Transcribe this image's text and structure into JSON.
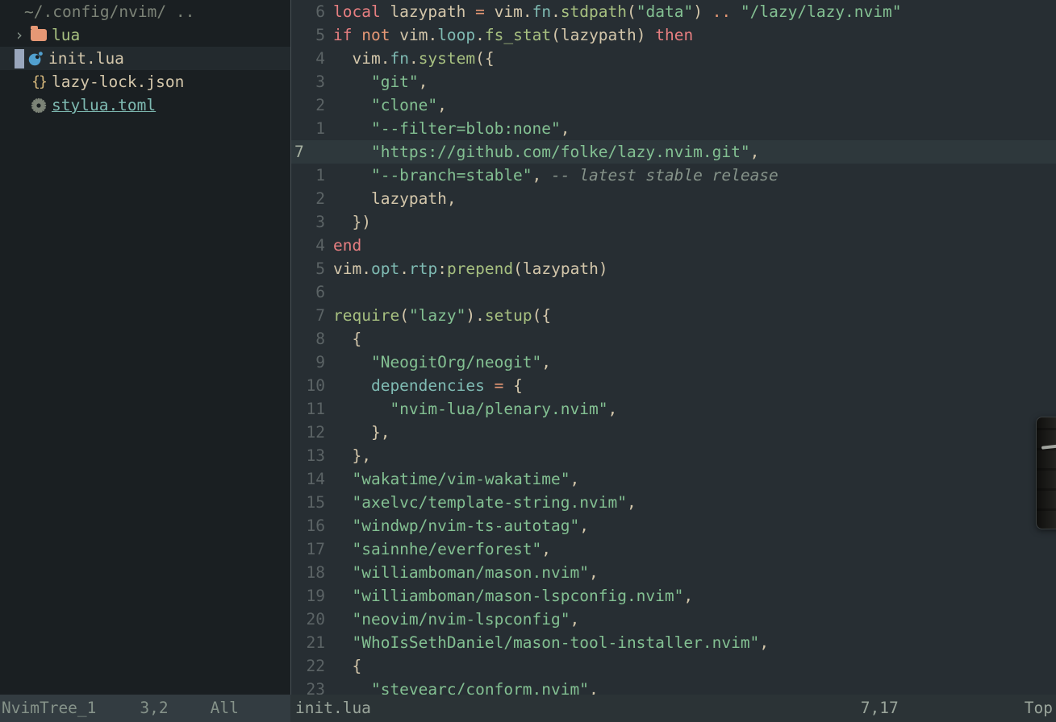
{
  "tree": {
    "root_label": "~/.config/nvim/ ..",
    "items": [
      {
        "icon": "chevron-right-icon",
        "type": "dir",
        "label": "lua",
        "selected": false,
        "indent": 1
      },
      {
        "icon": "lua-icon",
        "type": "file",
        "label": "init.lua",
        "selected": true,
        "indent": 1
      },
      {
        "icon": "json-icon",
        "type": "file",
        "label": "lazy-lock.json",
        "selected": false,
        "indent": 1
      },
      {
        "icon": "gear-icon",
        "type": "link",
        "label": "stylua.toml",
        "selected": false,
        "indent": 1
      }
    ]
  },
  "editor": {
    "filetype": "lua",
    "cursor_line_number": 7,
    "lines": [
      {
        "num": "6",
        "cursor": false,
        "tokens": [
          {
            "t": "kw",
            "v": "local"
          },
          {
            "t": "var",
            "v": " lazypath "
          },
          {
            "t": "op",
            "v": "="
          },
          {
            "t": "var",
            "v": " vim"
          },
          {
            "t": "punct",
            "v": "."
          },
          {
            "t": "field",
            "v": "fn"
          },
          {
            "t": "punct",
            "v": "."
          },
          {
            "t": "func",
            "v": "stdpath"
          },
          {
            "t": "punct",
            "v": "("
          },
          {
            "t": "str",
            "v": "\"data\""
          },
          {
            "t": "punct",
            "v": ")"
          },
          {
            "t": "op",
            "v": " .. "
          },
          {
            "t": "str",
            "v": "\"/lazy/lazy.nvim\""
          }
        ]
      },
      {
        "num": "5",
        "cursor": false,
        "tokens": [
          {
            "t": "kw",
            "v": "if "
          },
          {
            "t": "op",
            "v": "not"
          },
          {
            "t": "var",
            "v": " vim"
          },
          {
            "t": "punct",
            "v": "."
          },
          {
            "t": "field",
            "v": "loop"
          },
          {
            "t": "punct",
            "v": "."
          },
          {
            "t": "func",
            "v": "fs_stat"
          },
          {
            "t": "punct",
            "v": "("
          },
          {
            "t": "var",
            "v": "lazypath"
          },
          {
            "t": "punct",
            "v": ") "
          },
          {
            "t": "kw",
            "v": "then"
          }
        ]
      },
      {
        "num": "4",
        "cursor": false,
        "tokens": [
          {
            "t": "var",
            "v": "  vim"
          },
          {
            "t": "punct",
            "v": "."
          },
          {
            "t": "field",
            "v": "fn"
          },
          {
            "t": "punct",
            "v": "."
          },
          {
            "t": "func",
            "v": "system"
          },
          {
            "t": "punct",
            "v": "({"
          }
        ]
      },
      {
        "num": "3",
        "cursor": false,
        "tokens": [
          {
            "t": "str",
            "v": "    \"git\""
          },
          {
            "t": "punct",
            "v": ","
          }
        ]
      },
      {
        "num": "2",
        "cursor": false,
        "tokens": [
          {
            "t": "str",
            "v": "    \"clone\""
          },
          {
            "t": "punct",
            "v": ","
          }
        ]
      },
      {
        "num": "1",
        "cursor": false,
        "tokens": [
          {
            "t": "str",
            "v": "    \"--filter=blob:none\""
          },
          {
            "t": "punct",
            "v": ","
          }
        ]
      },
      {
        "num": "7",
        "cursor": true,
        "tokens": [
          {
            "t": "str",
            "v": "    \"https://github.com/folke/lazy.nvim.git\""
          },
          {
            "t": "punct",
            "v": ","
          }
        ]
      },
      {
        "num": "1",
        "cursor": false,
        "tokens": [
          {
            "t": "str",
            "v": "    \"--branch=stable\""
          },
          {
            "t": "punct",
            "v": ", "
          },
          {
            "t": "comment",
            "v": "-- latest stable release"
          }
        ]
      },
      {
        "num": "2",
        "cursor": false,
        "tokens": [
          {
            "t": "var",
            "v": "    lazypath"
          },
          {
            "t": "punct",
            "v": ","
          }
        ]
      },
      {
        "num": "3",
        "cursor": false,
        "tokens": [
          {
            "t": "punct",
            "v": "  })"
          }
        ]
      },
      {
        "num": "4",
        "cursor": false,
        "tokens": [
          {
            "t": "kw",
            "v": "end"
          }
        ]
      },
      {
        "num": "5",
        "cursor": false,
        "tokens": [
          {
            "t": "var",
            "v": "vim"
          },
          {
            "t": "punct",
            "v": "."
          },
          {
            "t": "field",
            "v": "opt"
          },
          {
            "t": "punct",
            "v": "."
          },
          {
            "t": "field",
            "v": "rtp"
          },
          {
            "t": "punct",
            "v": ":"
          },
          {
            "t": "func",
            "v": "prepend"
          },
          {
            "t": "punct",
            "v": "("
          },
          {
            "t": "var",
            "v": "lazypath"
          },
          {
            "t": "punct",
            "v": ")"
          }
        ]
      },
      {
        "num": "6",
        "cursor": false,
        "tokens": []
      },
      {
        "num": "7",
        "cursor": false,
        "tokens": [
          {
            "t": "func",
            "v": "require"
          },
          {
            "t": "punct",
            "v": "("
          },
          {
            "t": "str",
            "v": "\"lazy\""
          },
          {
            "t": "punct",
            "v": ")."
          },
          {
            "t": "func",
            "v": "setup"
          },
          {
            "t": "punct",
            "v": "({"
          }
        ]
      },
      {
        "num": "8",
        "cursor": false,
        "tokens": [
          {
            "t": "punct",
            "v": "  {"
          }
        ]
      },
      {
        "num": "9",
        "cursor": false,
        "tokens": [
          {
            "t": "str",
            "v": "    \"NeogitOrg/neogit\""
          },
          {
            "t": "punct",
            "v": ","
          }
        ]
      },
      {
        "num": "10",
        "cursor": false,
        "tokens": [
          {
            "t": "field",
            "v": "    dependencies"
          },
          {
            "t": "op",
            "v": " = "
          },
          {
            "t": "punct",
            "v": "{"
          }
        ]
      },
      {
        "num": "11",
        "cursor": false,
        "tokens": [
          {
            "t": "str",
            "v": "      \"nvim-lua/plenary.nvim\""
          },
          {
            "t": "punct",
            "v": ","
          }
        ]
      },
      {
        "num": "12",
        "cursor": false,
        "tokens": [
          {
            "t": "punct",
            "v": "    },"
          }
        ]
      },
      {
        "num": "13",
        "cursor": false,
        "tokens": [
          {
            "t": "punct",
            "v": "  },"
          }
        ]
      },
      {
        "num": "14",
        "cursor": false,
        "tokens": [
          {
            "t": "str",
            "v": "  \"wakatime/vim-wakatime\""
          },
          {
            "t": "punct",
            "v": ","
          }
        ]
      },
      {
        "num": "15",
        "cursor": false,
        "tokens": [
          {
            "t": "str",
            "v": "  \"axelvc/template-string.nvim\""
          },
          {
            "t": "punct",
            "v": ","
          }
        ]
      },
      {
        "num": "16",
        "cursor": false,
        "tokens": [
          {
            "t": "str",
            "v": "  \"windwp/nvim-ts-autotag\""
          },
          {
            "t": "punct",
            "v": ","
          }
        ]
      },
      {
        "num": "17",
        "cursor": false,
        "tokens": [
          {
            "t": "str",
            "v": "  \"sainnhe/everforest\""
          },
          {
            "t": "punct",
            "v": ","
          }
        ]
      },
      {
        "num": "18",
        "cursor": false,
        "tokens": [
          {
            "t": "str",
            "v": "  \"williamboman/mason.nvim\""
          },
          {
            "t": "punct",
            "v": ","
          }
        ]
      },
      {
        "num": "19",
        "cursor": false,
        "tokens": [
          {
            "t": "str",
            "v": "  \"williamboman/mason-lspconfig.nvim\""
          },
          {
            "t": "punct",
            "v": ","
          }
        ]
      },
      {
        "num": "20",
        "cursor": false,
        "tokens": [
          {
            "t": "str",
            "v": "  \"neovim/nvim-lspconfig\""
          },
          {
            "t": "punct",
            "v": ","
          }
        ]
      },
      {
        "num": "21",
        "cursor": false,
        "tokens": [
          {
            "t": "str",
            "v": "  \"WhoIsSethDaniel/mason-tool-installer.nvim\""
          },
          {
            "t": "punct",
            "v": ","
          }
        ]
      },
      {
        "num": "22",
        "cursor": false,
        "tokens": [
          {
            "t": "punct",
            "v": "  {"
          }
        ]
      },
      {
        "num": "23",
        "cursor": false,
        "tokens": [
          {
            "t": "str",
            "v": "    \"stevearc/conform.nvim\""
          },
          {
            "t": "punct",
            "v": ","
          }
        ]
      }
    ]
  },
  "statusline": {
    "left_window": "NvimTree_1",
    "left_position": "3,2",
    "left_scroll": "All",
    "right_file": "init.lua",
    "right_position": "7,17",
    "right_scroll": "Top"
  },
  "colors": {
    "tree_bg": "#1a1f22",
    "editor_bg": "#272e33",
    "cursorline_bg": "#2e383c",
    "status_left_bg": "#333c41",
    "status_right_bg": "#2b3336",
    "keyword": "#e67e80",
    "operator": "#e69875",
    "string": "#83c092",
    "function": "#a7c080",
    "field": "#7fbbb3",
    "variable": "#d3c6aa",
    "comment": "#859289",
    "linenr": "#5b6365",
    "cursor_linenr": "#a6b0a0",
    "folder_icon": "#e69875",
    "lua_icon": "#51a0cf",
    "json_icon": "#dbbc7f",
    "gear_icon": "#7c8377",
    "link": "#7fbbb3"
  }
}
